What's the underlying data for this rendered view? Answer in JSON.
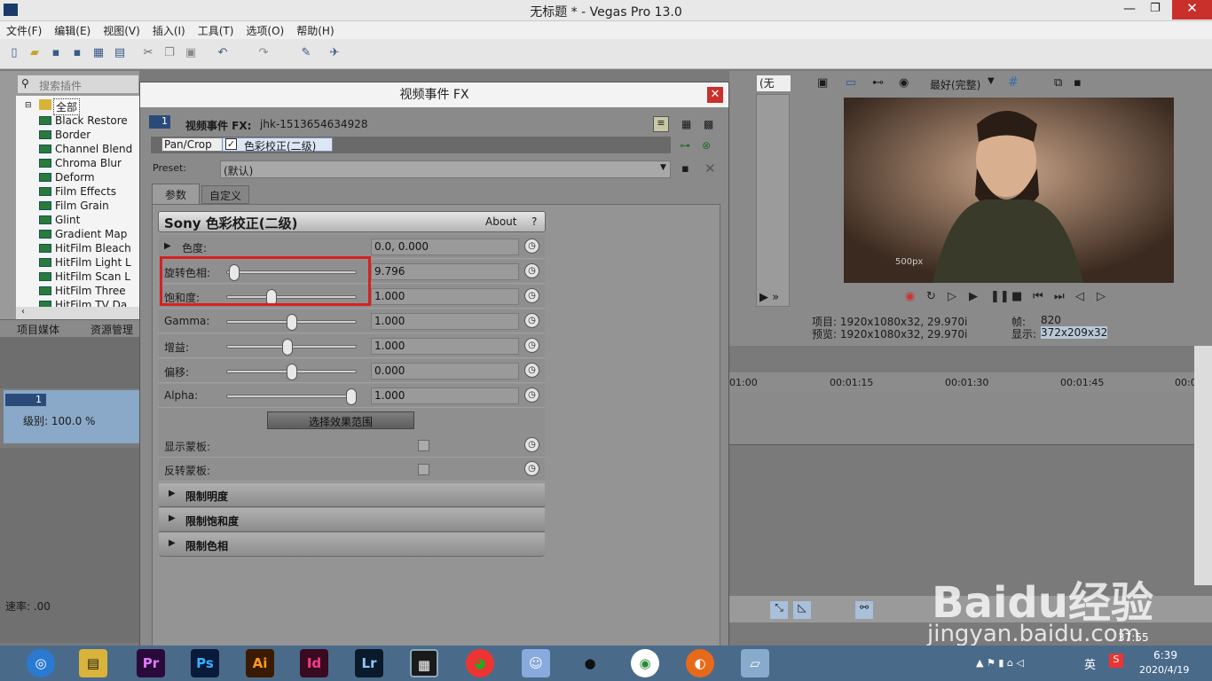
{
  "window": {
    "title": "无标题 * - Vegas Pro 13.0"
  },
  "menu": [
    "文件(F)",
    "编辑(E)",
    "视图(V)",
    "插入(I)",
    "工具(T)",
    "选项(O)",
    "帮助(H)"
  ],
  "plugins": {
    "search_placeholder": "搜索插件",
    "root": "全部",
    "items": [
      "Black Restore",
      "Border",
      "Channel Blend",
      "Chroma Blur",
      "Deform",
      "Film Effects",
      "Film Grain",
      "Glint",
      "Gradient Map",
      "HitFilm Bleach",
      "HitFilm Light L",
      "HitFilm Scan L",
      "HitFilm Three",
      "HitFilm TV Da"
    ]
  },
  "left_tabs": [
    "项目媒体",
    "资源管理器"
  ],
  "track": {
    "number": "1",
    "level": "级别: 100.0 %"
  },
  "rate": "速率: .00",
  "dialog": {
    "title": "视频事件 FX",
    "event_label": "视频事件 FX:",
    "event_id": "jhk-1513654634928",
    "chain": [
      "Pan/Crop",
      "色彩校正(二级)"
    ],
    "preset_label": "Preset:",
    "preset_value": "(默认)",
    "tabs": [
      "参数",
      "自定义"
    ],
    "plugin_name": "Sony 色彩校正(二级)",
    "about": "About",
    "help": "?",
    "params": [
      {
        "label": "色度:",
        "value": "0.0, 0.000",
        "slider": null
      },
      {
        "label": "旋转色相:",
        "value": "9.796",
        "slider": 0.02
      },
      {
        "label": "饱和度:",
        "value": "1.000",
        "slider": 0.33
      },
      {
        "label": "Gamma:",
        "value": "1.000",
        "slider": 0.5
      },
      {
        "label": "增益:",
        "value": "1.000",
        "slider": 0.47
      },
      {
        "label": "偏移:",
        "value": "0.000",
        "slider": 0.5
      },
      {
        "label": "Alpha:",
        "value": "1.000",
        "slider": 1.0
      }
    ],
    "select_range_button": "选择效果范围",
    "show_mask": "显示蒙板:",
    "invert_mask": "反转蒙板:",
    "sections": [
      "限制明度",
      "限制饱和度",
      "限制色相"
    ]
  },
  "preview": {
    "quality": "最好(完整)",
    "none_select": "(无",
    "project_info": "项目: 1920x1080x32, 29.970i",
    "preview_info": "预览: 1920x1080x32, 29.970i",
    "frame_label": "帧:",
    "frame_value": "820",
    "display_label": "显示:",
    "display_value": "372x209x32",
    "watermark": "500px"
  },
  "timeline": {
    "ticks": [
      "01:00",
      "00:01:15",
      "00:01:30",
      "00:01:45",
      "00:0"
    ],
    "time": "37:55"
  },
  "tray": {
    "ime": "英",
    "time": "6:39",
    "date": "2020/4/19"
  },
  "baidu": {
    "logo": "Baidu经验",
    "url": "jingyan.baidu.com"
  },
  "taskbar_apps": [
    "Pr",
    "Ps",
    "Ai",
    "Id",
    "Lr"
  ]
}
